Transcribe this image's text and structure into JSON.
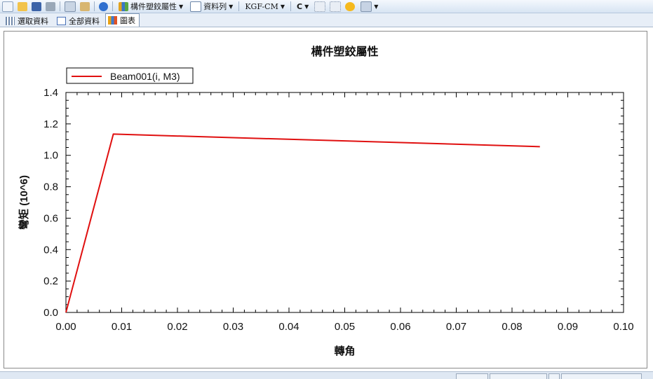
{
  "toolbar": {
    "combo_property": "構件塑鉸屬性",
    "combo_data": "資料列",
    "combo_unit": "KGF-CM",
    "combo_c": "C"
  },
  "tabs": [
    {
      "label": "選取資料",
      "active": false
    },
    {
      "label": "全部資料",
      "active": false
    },
    {
      "label": "圖表",
      "active": true
    }
  ],
  "chart_data": {
    "type": "line",
    "title": "構件塑鉸屬性",
    "xlabel": "轉角",
    "ylabel": "彎矩 (10^6)",
    "xlim": [
      0.0,
      0.1
    ],
    "ylim": [
      0.0,
      1.4
    ],
    "x_ticks": [
      "0.00",
      "0.01",
      "0.02",
      "0.03",
      "0.04",
      "0.05",
      "0.06",
      "0.07",
      "0.08",
      "0.09",
      "0.10"
    ],
    "y_ticks": [
      "0.0",
      "0.2",
      "0.4",
      "0.6",
      "0.8",
      "1.0",
      "1.2",
      "1.4"
    ],
    "grid": false,
    "legend_position": "top-left",
    "series": [
      {
        "name": "Beam001(i, M3)",
        "color": "#e01010",
        "x": [
          0.0,
          0.0085,
          0.085
        ],
        "y": [
          0.0,
          1.135,
          1.055
        ]
      }
    ]
  }
}
